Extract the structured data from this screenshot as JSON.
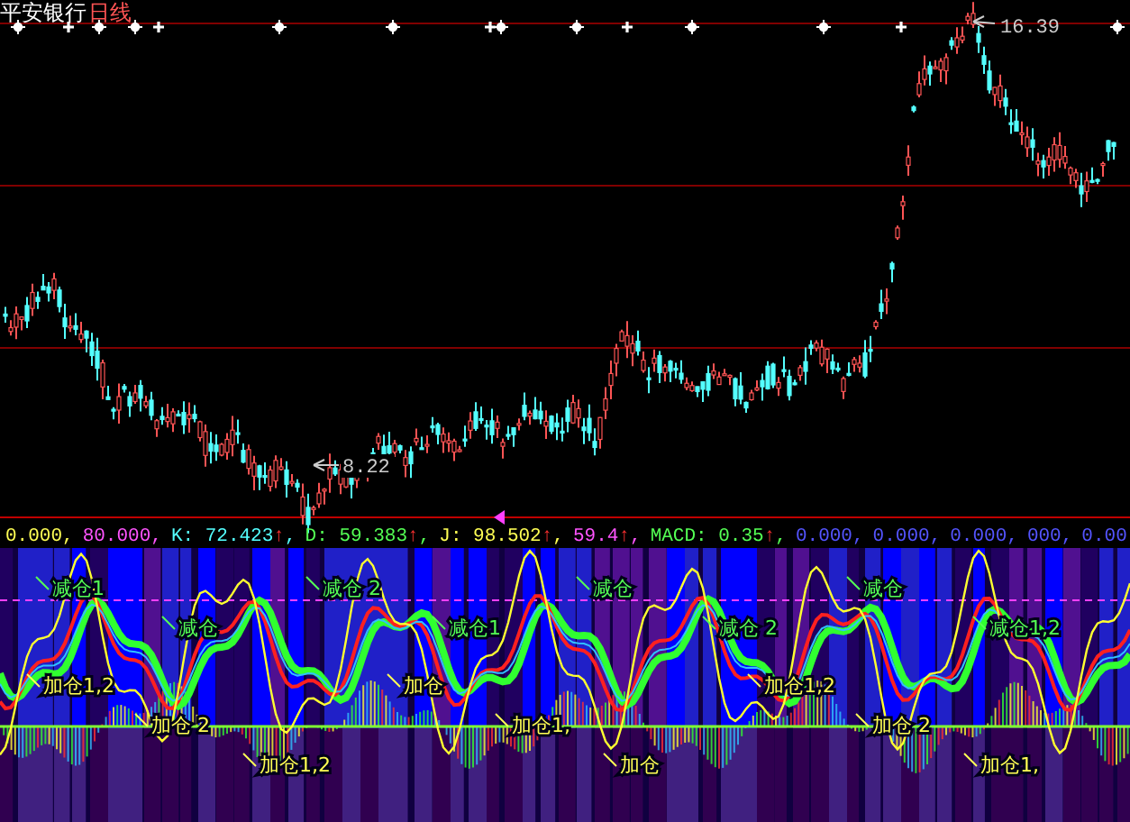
{
  "price_chart": {
    "stock_name": "平安银行",
    "period": "日线",
    "high_label": "16.39",
    "low_label": "8.22"
  },
  "indicator": {
    "values": [
      {
        "label": "0.000",
        "sep": ",",
        "color": "#ffff54"
      },
      {
        "label": "80.000",
        "sep": ",",
        "color": "#ff54ff"
      },
      {
        "label": "K: 72.423",
        "arrow": "↑",
        "sep": ",",
        "color": "#54ffff"
      },
      {
        "label": "D: 59.383",
        "arrow": "↑",
        "sep": ",",
        "color": "#54ff54"
      },
      {
        "label": "J: 98.502",
        "arrow": "↑",
        "sep": ",",
        "color": "#ffff54"
      },
      {
        "label": "59.4",
        "arrow": "↑",
        "sep": ",",
        "color": "#ff54ff"
      },
      {
        "label": "MACD: 0.35",
        "arrow": "↑",
        "sep": ",",
        "color": "#54ff54"
      },
      {
        "label": "0.000",
        "sep": ",",
        "color": "#5454ff"
      },
      {
        "label": "0.000",
        "sep": ",",
        "color": "#5454ff"
      },
      {
        "label": "0.000",
        "sep": ",",
        "color": "#5454ff"
      },
      {
        "label": "000",
        "sep": ",",
        "color": "#5454ff"
      },
      {
        "label": "0.00",
        "color": "#5454ff"
      }
    ],
    "signals": [
      {
        "kind": "reduce",
        "text": "减仓1"
      },
      {
        "kind": "reduce",
        "text": "减仓  2"
      },
      {
        "kind": "add",
        "text": "加仓1,2"
      },
      {
        "kind": "add",
        "text": "加仓"
      },
      {
        "kind": "add",
        "text": "加仓1,2"
      },
      {
        "kind": "reduce",
        "text": "减仓"
      },
      {
        "kind": "add",
        "text": "加仓  2"
      },
      {
        "kind": "reduce",
        "text": "减仓"
      },
      {
        "kind": "add",
        "text": "加仓1,"
      },
      {
        "kind": "reduce",
        "text": "减仓"
      },
      {
        "kind": "add",
        "text": "加仓  2"
      },
      {
        "kind": "reduce",
        "text": "减仓1"
      },
      {
        "kind": "add",
        "text": "加仓1,2"
      },
      {
        "kind": "reduce",
        "text": "减仓  2"
      },
      {
        "kind": "add",
        "text": "加仓"
      },
      {
        "kind": "reduce",
        "text": "减仓1,2"
      },
      {
        "kind": "add",
        "text": "加仓1,"
      }
    ]
  }
}
